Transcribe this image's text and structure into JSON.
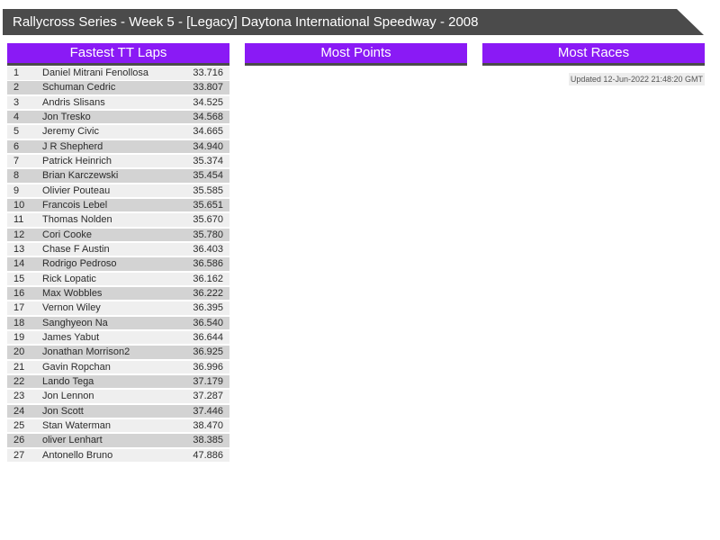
{
  "colors": {
    "accent_purple": "#8a1af5",
    "bar_gray": "#4b4b4b",
    "row_odd": "#efefef",
    "row_even": "#d3d3d3",
    "updated_bg": "#ededed"
  },
  "title_bar": {
    "title": "Rallycross Series - Week 5 - [Legacy] Daytona International Speedway - 2008"
  },
  "sections": {
    "fastest_tt_laps": {
      "title": "Fastest TT Laps"
    },
    "most_points": {
      "title": "Most Points"
    },
    "most_races": {
      "title": "Most Races",
      "updated": "Updated 12-Jun-2022 21:48:20 GMT"
    }
  },
  "fastest_tt_laps_table": {
    "columns": [
      "rank",
      "name",
      "time"
    ],
    "rows": [
      {
        "rank": "1",
        "name": "Daniel Mitrani Fenollosa",
        "time": "33.716"
      },
      {
        "rank": "2",
        "name": "Schuman Cedric",
        "time": "33.807"
      },
      {
        "rank": "3",
        "name": "Andris Slisans",
        "time": "34.525"
      },
      {
        "rank": "4",
        "name": "Jon Tresko",
        "time": "34.568"
      },
      {
        "rank": "5",
        "name": "Jeremy Civic",
        "time": "34.665"
      },
      {
        "rank": "6",
        "name": "J R Shepherd",
        "time": "34.940"
      },
      {
        "rank": "7",
        "name": "Patrick Heinrich",
        "time": "35.374"
      },
      {
        "rank": "8",
        "name": "Brian Karczewski",
        "time": "35.454"
      },
      {
        "rank": "9",
        "name": "Olivier Pouteau",
        "time": "35.585"
      },
      {
        "rank": "10",
        "name": "Francois Lebel",
        "time": "35.651"
      },
      {
        "rank": "11",
        "name": "Thomas Nolden",
        "time": "35.670"
      },
      {
        "rank": "12",
        "name": "Cori Cooke",
        "time": "35.780"
      },
      {
        "rank": "13",
        "name": "Chase F Austin",
        "time": "36.403"
      },
      {
        "rank": "14",
        "name": "Rodrigo Pedroso",
        "time": "36.586"
      },
      {
        "rank": "15",
        "name": "Rick Lopatic",
        "time": "36.162"
      },
      {
        "rank": "16",
        "name": "Max Wobbles",
        "time": "36.222"
      },
      {
        "rank": "17",
        "name": "Vernon Wiley",
        "time": "36.395"
      },
      {
        "rank": "18",
        "name": "Sanghyeon Na",
        "time": "36.540"
      },
      {
        "rank": "19",
        "name": "James Yabut",
        "time": "36.644"
      },
      {
        "rank": "20",
        "name": "Jonathan Morrison2",
        "time": "36.925"
      },
      {
        "rank": "21",
        "name": "Gavin Ropchan",
        "time": "36.996"
      },
      {
        "rank": "22",
        "name": "Lando Tega",
        "time": "37.179"
      },
      {
        "rank": "23",
        "name": "Jon Lennon",
        "time": "37.287"
      },
      {
        "rank": "24",
        "name": "Jon Scott",
        "time": "37.446"
      },
      {
        "rank": "25",
        "name": "Stan Waterman",
        "time": "38.470"
      },
      {
        "rank": "26",
        "name": "oliver Lenhart",
        "time": "38.385"
      },
      {
        "rank": "27",
        "name": "Antonello Bruno",
        "time": "47.886"
      }
    ]
  }
}
